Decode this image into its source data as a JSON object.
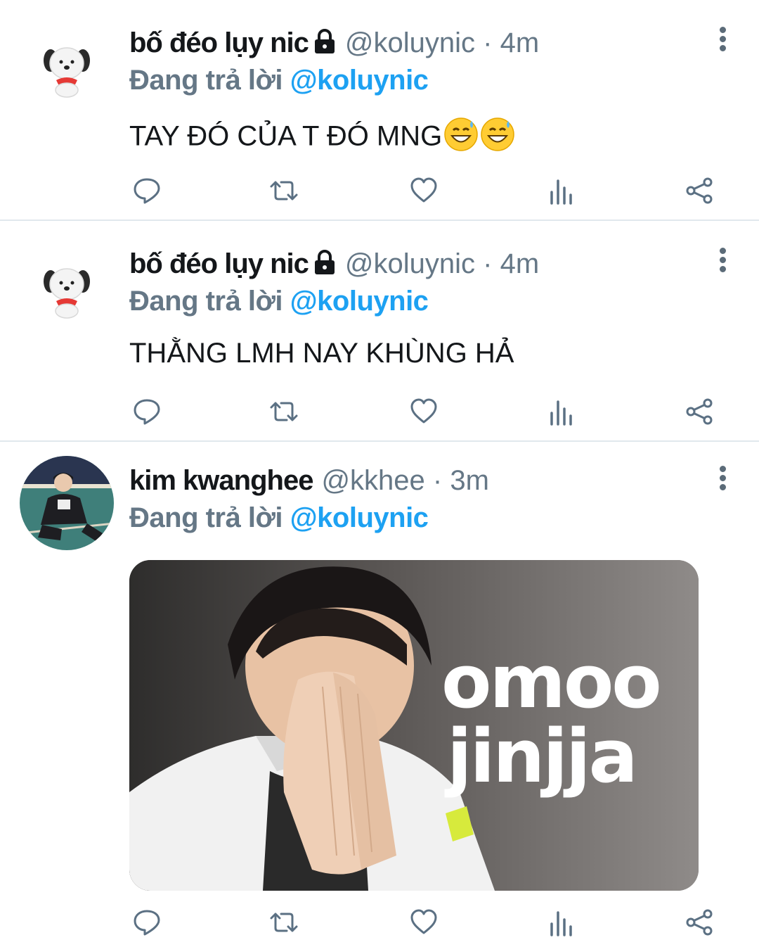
{
  "tweets": [
    {
      "display_name": "bố đéo lụy nic",
      "handle_time": "@koluynic · 4m",
      "reply_prefix": "Đang trả lời",
      "reply_mention": "@koluynic",
      "text": "TAY ĐÓ CỦA T ĐÓ MNG",
      "emojis": [
        "grinning-sweat-emoji",
        "grinning-sweat-emoji"
      ],
      "protected": true
    },
    {
      "display_name": "bố đéo lụy nic",
      "handle_time": "@koluynic · 4m",
      "reply_prefix": "Đang trả lời",
      "reply_mention": "@koluynic",
      "text": "THẰNG LMH NAY KHÙNG HẢ",
      "protected": true
    },
    {
      "display_name": "kim kwanghee",
      "handle_time": "@kkhee · 3m",
      "reply_prefix": "Đang trả lời",
      "reply_mention": "@koluynic",
      "media": {
        "line1": "omoo",
        "line2": "jinjja"
      },
      "protected": false
    }
  ],
  "icons": {
    "actions": [
      "reply-icon",
      "retweet-icon",
      "like-icon",
      "analytics-icon",
      "share-icon"
    ],
    "menu": "more-options-icon",
    "lock": "lock-icon"
  },
  "colors": {
    "text": "#14171a",
    "secondary": "#657786",
    "link": "#1da1f2",
    "divider": "#e1e8ed",
    "icon": "#5b7083"
  }
}
